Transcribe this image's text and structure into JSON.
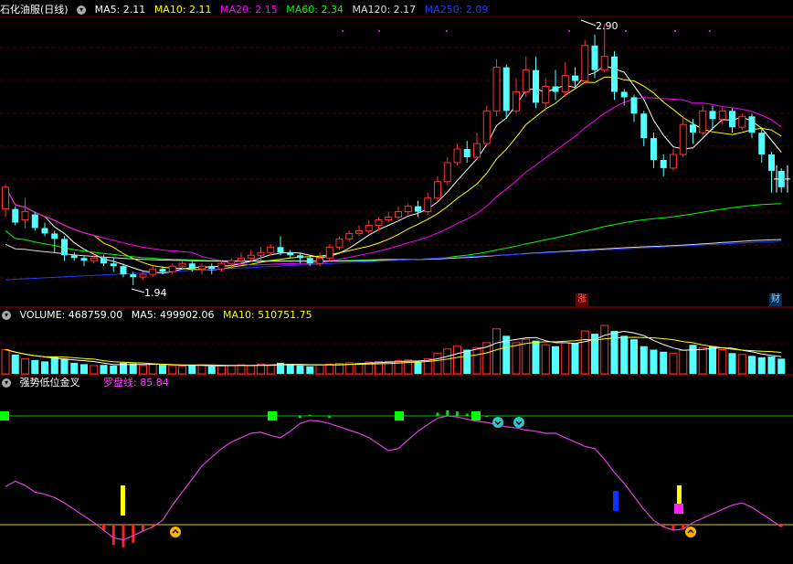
{
  "main_panel": {
    "title": "石化油服(日线)",
    "ma5_label": "MA5: 2.11",
    "ma10_label": "MA10: 2.11",
    "ma20_label": "MA20: 2.15",
    "ma60_label": "MA60: 2.34",
    "ma120_label": "MA120: 2.17",
    "ma250_label": "MA250: 2.09",
    "high_marker": "2.90",
    "low_marker": "1.94",
    "badge_zhang": "涨",
    "badge_cai": "财"
  },
  "volume_panel": {
    "volume_label": "VOLUME: 468759.00",
    "ma5_label": "MA5: 499902.06",
    "ma10_label": "MA10: 510751.75"
  },
  "indicator_panel": {
    "title": "强势低位金叉",
    "line_label": "罗盘线: 85.84"
  },
  "colors": {
    "up": "#ff3232",
    "down": "#54ffff",
    "ma5": "#ffffff",
    "ma10": "#ffff00",
    "ma20": "#ff00ff",
    "ma60": "#00ff00",
    "ma120": "#dddddd",
    "ma250": "#1c3cff",
    "grid": "#7a0000"
  },
  "chart_data": {
    "type": "candlestick",
    "price_high": 2.9,
    "price_low": 1.94,
    "candles": [
      [
        2.22,
        2.3,
        2.19,
        2.31
      ],
      [
        2.22,
        2.17,
        2.16,
        2.23
      ],
      [
        2.18,
        2.21,
        2.15,
        2.26
      ],
      [
        2.2,
        2.15,
        2.14,
        2.21
      ],
      [
        2.15,
        2.13,
        2.12,
        2.17
      ],
      [
        2.13,
        2.11,
        2.06,
        2.14
      ],
      [
        2.11,
        2.05,
        2.03,
        2.12
      ],
      [
        2.05,
        2.04,
        2.03,
        2.06
      ],
      [
        2.04,
        2.03,
        2.01,
        2.05
      ],
      [
        2.03,
        2.04,
        2.02,
        2.06
      ],
      [
        2.04,
        2.02,
        2.01,
        2.05
      ],
      [
        2.02,
        2.01,
        1.99,
        2.04
      ],
      [
        2.01,
        1.98,
        1.97,
        2.02
      ],
      [
        1.98,
        1.97,
        1.94,
        1.99
      ],
      [
        1.97,
        1.98,
        1.96,
        1.99
      ],
      [
        1.98,
        2.0,
        1.97,
        2.01
      ],
      [
        2.0,
        1.99,
        1.98,
        2.01
      ],
      [
        1.99,
        2.01,
        1.98,
        2.02
      ],
      [
        2.01,
        2.02,
        2.0,
        2.03
      ],
      [
        2.02,
        2.0,
        1.99,
        2.03
      ],
      [
        2.0,
        2.01,
        1.98,
        2.02
      ],
      [
        2.01,
        2.0,
        1.98,
        2.02
      ],
      [
        2.0,
        2.02,
        1.99,
        2.03
      ],
      [
        2.02,
        2.03,
        2.0,
        2.04
      ],
      [
        2.03,
        2.04,
        2.02,
        2.06
      ],
      [
        2.04,
        2.05,
        2.03,
        2.07
      ],
      [
        2.05,
        2.06,
        2.03,
        2.08
      ],
      [
        2.06,
        2.08,
        2.05,
        2.09
      ],
      [
        2.08,
        2.06,
        2.05,
        2.12
      ],
      [
        2.06,
        2.05,
        2.04,
        2.07
      ],
      [
        2.05,
        2.04,
        2.02,
        2.06
      ],
      [
        2.04,
        2.02,
        2.01,
        2.05
      ],
      [
        2.02,
        2.04,
        2.01,
        2.06
      ],
      [
        2.04,
        2.08,
        2.03,
        2.09
      ],
      [
        2.08,
        2.11,
        2.07,
        2.12
      ],
      [
        2.11,
        2.13,
        2.1,
        2.14
      ],
      [
        2.13,
        2.14,
        2.12,
        2.16
      ],
      [
        2.14,
        2.16,
        2.13,
        2.18
      ],
      [
        2.16,
        2.18,
        2.14,
        2.19
      ],
      [
        2.18,
        2.19,
        2.17,
        2.21
      ],
      [
        2.19,
        2.21,
        2.18,
        2.23
      ],
      [
        2.21,
        2.23,
        2.2,
        2.24
      ],
      [
        2.23,
        2.21,
        2.19,
        2.25
      ],
      [
        2.21,
        2.26,
        2.2,
        2.28
      ],
      [
        2.26,
        2.32,
        2.25,
        2.34
      ],
      [
        2.32,
        2.39,
        2.31,
        2.41
      ],
      [
        2.39,
        2.44,
        2.38,
        2.46
      ],
      [
        2.44,
        2.41,
        2.39,
        2.47
      ],
      [
        2.41,
        2.46,
        2.4,
        2.5
      ],
      [
        2.46,
        2.58,
        2.45,
        2.6
      ],
      [
        2.58,
        2.74,
        2.56,
        2.77
      ],
      [
        2.74,
        2.58,
        2.55,
        2.75
      ],
      [
        2.58,
        2.65,
        2.57,
        2.7
      ],
      [
        2.65,
        2.73,
        2.63,
        2.78
      ],
      [
        2.73,
        2.61,
        2.59,
        2.78
      ],
      [
        2.61,
        2.67,
        2.58,
        2.7
      ],
      [
        2.67,
        2.65,
        2.62,
        2.73
      ],
      [
        2.65,
        2.71,
        2.63,
        2.76
      ],
      [
        2.71,
        2.69,
        2.66,
        2.74
      ],
      [
        2.69,
        2.82,
        2.68,
        2.84
      ],
      [
        2.82,
        2.73,
        2.7,
        2.86
      ],
      [
        2.73,
        2.78,
        2.72,
        2.9
      ],
      [
        2.78,
        2.65,
        2.62,
        2.8
      ],
      [
        2.65,
        2.63,
        2.6,
        2.66
      ],
      [
        2.63,
        2.57,
        2.54,
        2.64
      ],
      [
        2.57,
        2.48,
        2.45,
        2.58
      ],
      [
        2.48,
        2.4,
        2.37,
        2.5
      ],
      [
        2.4,
        2.37,
        2.34,
        2.42
      ],
      [
        2.37,
        2.42,
        2.36,
        2.44
      ],
      [
        2.42,
        2.53,
        2.41,
        2.56
      ],
      [
        2.53,
        2.5,
        2.46,
        2.55
      ],
      [
        2.5,
        2.58,
        2.49,
        2.6
      ],
      [
        2.58,
        2.55,
        2.51,
        2.6
      ],
      [
        2.55,
        2.58,
        2.53,
        2.59
      ],
      [
        2.58,
        2.52,
        2.5,
        2.59
      ],
      [
        2.52,
        2.56,
        2.51,
        2.57
      ],
      [
        2.56,
        2.5,
        2.48,
        2.57
      ],
      [
        2.5,
        2.42,
        2.39,
        2.52
      ],
      [
        2.42,
        2.36,
        2.28,
        2.43
      ],
      [
        2.36,
        2.3,
        2.28,
        2.37
      ]
    ],
    "volumes": [
      35,
      28,
      22,
      20,
      18,
      25,
      22,
      16,
      14,
      12,
      13,
      12,
      16,
      15,
      12,
      14,
      13,
      12,
      11,
      12,
      13,
      11,
      12,
      12,
      13,
      12,
      14,
      13,
      16,
      14,
      12,
      11,
      13,
      14,
      15,
      16,
      15,
      17,
      18,
      18,
      19,
      20,
      18,
      22,
      30,
      36,
      40,
      35,
      38,
      45,
      65,
      55,
      45,
      50,
      48,
      42,
      40,
      45,
      44,
      62,
      58,
      70,
      62,
      55,
      50,
      40,
      35,
      32,
      30,
      34,
      42,
      38,
      40,
      35,
      30,
      28,
      26,
      24,
      25,
      22
    ],
    "compass_line": [
      35,
      40,
      36,
      30,
      28,
      25,
      20,
      14,
      8,
      2,
      -5,
      -12,
      -14,
      -10,
      -6,
      -2,
      4,
      18,
      30,
      42,
      54,
      62,
      70,
      76,
      80,
      84,
      85,
      82,
      80,
      86,
      93,
      96,
      95,
      93,
      90,
      87,
      84,
      80,
      74,
      68,
      70,
      78,
      86,
      92,
      98,
      100,
      99,
      97,
      95,
      94,
      92,
      90,
      89,
      87,
      86,
      84,
      84,
      80,
      76,
      72,
      70,
      60,
      48,
      38,
      26,
      14,
      4,
      -2,
      -5,
      -4,
      2,
      6,
      10,
      14,
      18,
      20,
      16,
      10,
      4,
      -2
    ],
    "compass_current": 85.84
  }
}
